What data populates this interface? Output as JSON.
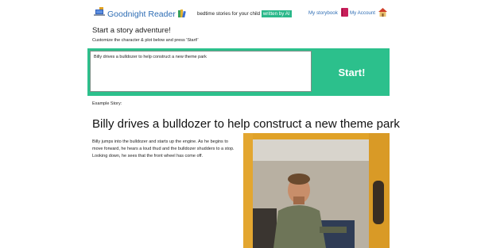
{
  "header": {
    "app_title": "Goodnight Reader",
    "tagline_prefix": "bedtime stories for your child",
    "tagline_highlight": "written by AI",
    "nav_storybook": "My storybook",
    "nav_account": "My Account"
  },
  "form": {
    "section_title": "Start a story adventure!",
    "instructions": "Customize the character & plot below and press 'Start!'",
    "prompt_value": "Billy drives a bulldozer to help construct a new theme park",
    "start_label": "Start!"
  },
  "example": {
    "label": "Example Story:",
    "title": "Billy drives a bulldozer to help construct a new theme park",
    "body": "Billy jumps into the bulldozer and starts up the engine. As he begins to move forward, he hears a loud thud and the bulldozer shudders to a stop. Looking down, he sees that the front wheel has come off."
  },
  "colors": {
    "accent": "#2cc08c",
    "link": "#2e6db4"
  },
  "icons": {
    "logo": "laptop-icon",
    "books": "books-icon",
    "storybook": "book-icon",
    "account": "home-icon"
  }
}
